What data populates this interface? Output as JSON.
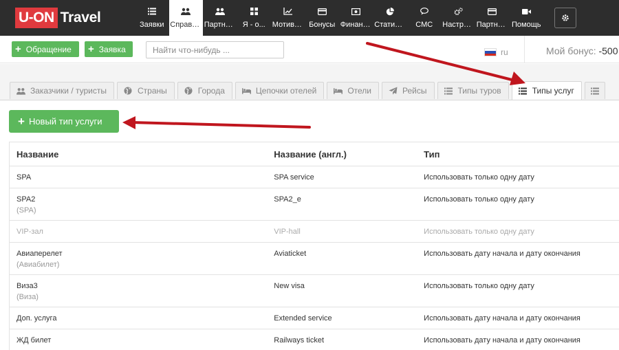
{
  "app": {
    "logo_box": "U-ON",
    "logo_text": "Travel"
  },
  "nav": [
    {
      "label": "Заявки",
      "icon": "list-icon"
    },
    {
      "label": "Справочники",
      "icon": "users-icon",
      "active": true
    },
    {
      "label": "Партнеры",
      "icon": "users-icon"
    },
    {
      "label": "Я - о...",
      "icon": "grid-icon"
    },
    {
      "label": "Мотивация",
      "icon": "chart-line-icon"
    },
    {
      "label": "Бонусы",
      "icon": "card-icon"
    },
    {
      "label": "Финансы",
      "icon": "money-icon"
    },
    {
      "label": "Статистика",
      "icon": "pie-chart-icon"
    },
    {
      "label": "СМС",
      "icon": "chat-icon"
    },
    {
      "label": "Настройки",
      "icon": "cogs-icon"
    },
    {
      "label": "Партнеры",
      "icon": "card-icon"
    },
    {
      "label": "Помощь",
      "icon": "video-icon"
    }
  ],
  "toolbar": {
    "request_label": "Обращение",
    "order_label": "Заявка",
    "search_placeholder": "Найти что-нибудь ...",
    "lang": "ru",
    "bonus_label": "Мой бонус:",
    "bonus_value": "-500"
  },
  "tabs": [
    {
      "label": "Заказчики / туристы",
      "icon": "users-icon"
    },
    {
      "label": "Страны",
      "icon": "globe-icon"
    },
    {
      "label": "Города",
      "icon": "globe-icon"
    },
    {
      "label": "Цепочки отелей",
      "icon": "bed-icon"
    },
    {
      "label": "Отели",
      "icon": "bed-icon"
    },
    {
      "label": "Рейсы",
      "icon": "plane-icon"
    },
    {
      "label": "Типы туров",
      "icon": "list-icon"
    },
    {
      "label": "Типы услуг",
      "icon": "list-icon",
      "active": true
    }
  ],
  "new_button_label": "Новый тип услуги",
  "table": {
    "headers": [
      "Название",
      "Название (англ.)",
      "Тип"
    ],
    "rows": [
      {
        "name": "SPA",
        "name_sub": "",
        "name_en": "SPA service",
        "type": "Использовать только одну дату",
        "muted": false
      },
      {
        "name": "SPA2",
        "name_sub": "(SPA)",
        "name_en": "SPA2_e",
        "type": "Использовать только одну дату",
        "muted": false
      },
      {
        "name": "VIP-зал",
        "name_sub": "",
        "name_en": "VIP-hall",
        "type": "Использовать только одну дату",
        "muted": true
      },
      {
        "name": "Авиаперелет",
        "name_sub": "(Авиабилет)",
        "name_en": "Aviaticket",
        "type": "Использовать дату начала и дату окончания",
        "muted": false
      },
      {
        "name": "Виза3",
        "name_sub": "(Виза)",
        "name_en": "New visa",
        "type": "Использовать только одну дату",
        "muted": false
      },
      {
        "name": "Доп. услуга",
        "name_sub": "",
        "name_en": "Extended service",
        "type": "Использовать дату начала и дату окончания",
        "muted": false
      },
      {
        "name": "ЖД билет",
        "name_sub": "",
        "name_en": "Railways ticket",
        "type": "Использовать дату начала и дату окончания",
        "muted": false
      }
    ]
  },
  "colors": {
    "accent_green": "#5cb85c",
    "topbar": "#2d2d2d",
    "logo_red": "#e03a3e",
    "annotation_arrow": "#c0161e"
  }
}
